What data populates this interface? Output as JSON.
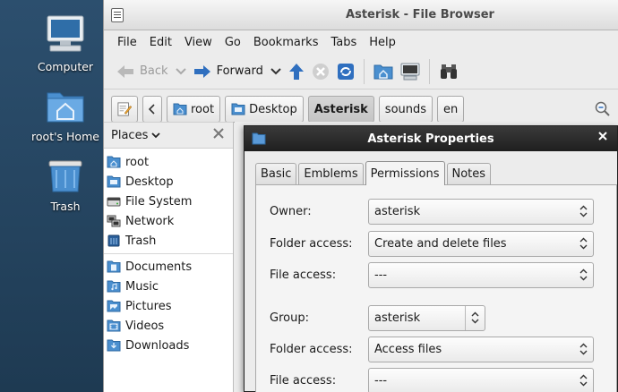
{
  "desktop": {
    "icons": [
      {
        "label": "Computer"
      },
      {
        "label": "root's Home"
      },
      {
        "label": "Trash"
      }
    ]
  },
  "window": {
    "title": "Asterisk - File Browser",
    "menu": [
      "File",
      "Edit",
      "View",
      "Go",
      "Bookmarks",
      "Tabs",
      "Help"
    ],
    "toolbar": {
      "back_label": "Back",
      "forward_label": "Forward"
    },
    "path": [
      "root",
      "Desktop",
      "Asterisk",
      "sounds",
      "en"
    ],
    "active_path_index": 2
  },
  "sidebar": {
    "header": "Places",
    "items_group1": [
      "root",
      "Desktop",
      "File System",
      "Network",
      "Trash"
    ],
    "items_group2": [
      "Documents",
      "Music",
      "Pictures",
      "Videos",
      "Downloads"
    ]
  },
  "dialog": {
    "title": "Asterisk Properties",
    "tabs": [
      "Basic",
      "Emblems",
      "Permissions",
      "Notes"
    ],
    "active_tab": "Permissions",
    "owner": {
      "label": "Owner:",
      "value": "asterisk"
    },
    "owner_folder_access": {
      "label": "Folder access:",
      "value": "Create and delete files"
    },
    "owner_file_access": {
      "label": "File access:",
      "value": "---"
    },
    "group": {
      "label": "Group:",
      "value": "asterisk"
    },
    "group_folder_access": {
      "label": "Folder access:",
      "value": "Access files"
    },
    "group_file_access": {
      "label": "File access:",
      "value": "---"
    }
  }
}
